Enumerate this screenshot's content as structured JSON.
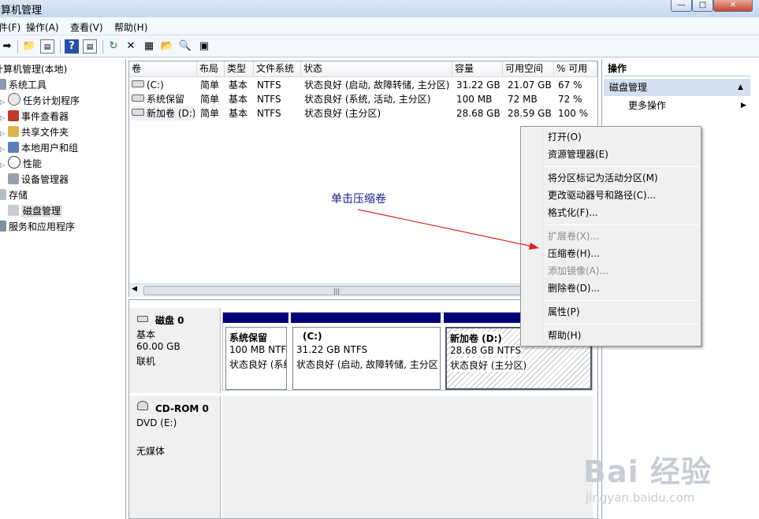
{
  "window": {
    "title": "计算机管理",
    "buttons": [
      "—",
      "□",
      "✕"
    ]
  },
  "menubar": [
    "文件(F)",
    "操作(A)",
    "查看(V)",
    "帮助(H)"
  ],
  "tree": {
    "root": "计算机管理(本地)",
    "system_tools": "系统工具",
    "items": [
      "任务计划程序",
      "事件查看器",
      "共享文件夹",
      "本地用户和组",
      "性能",
      "设备管理器"
    ],
    "storage": "存储",
    "disk_mgmt": "磁盘管理",
    "services": "服务和应用程序"
  },
  "volume_table": {
    "headers": [
      "卷",
      "布局",
      "类型",
      "文件系统",
      "状态",
      "容量",
      "可用空间",
      "% 可用"
    ],
    "rows": [
      [
        "(C:)",
        "简单",
        "基本",
        "NTFS",
        "状态良好 (启动, 故障转储, 主分区)",
        "31.22 GB",
        "21.07 GB",
        "67 %"
      ],
      [
        "系统保留",
        "简单",
        "基本",
        "NTFS",
        "状态良好 (系统, 活动, 主分区)",
        "100 MB",
        "72 MB",
        "72 %"
      ],
      [
        "新加卷 (D:)",
        "简单",
        "基本",
        "NTFS",
        "状态良好 (主分区)",
        "28.68 GB",
        "28.59 GB",
        "100 %"
      ]
    ]
  },
  "disks": {
    "disk0": {
      "name": "磁盘 0",
      "type": "基本",
      "size": "60.00 GB",
      "status": "联机",
      "partitions": [
        {
          "name": "系统保留",
          "size": "100 MB NTFS",
          "status": "状态良好 (系统"
        },
        {
          "name": "(C:)",
          "size": "31.22 GB NTFS",
          "status": "状态良好 (启动, 故障转储, 主分区"
        },
        {
          "name": "新加卷  (D:)",
          "size": "28.68 GB NTFS",
          "status": "状态良好 (主分区)"
        }
      ]
    },
    "cdrom0": {
      "name": "CD-ROM 0",
      "drive": "DVD (E:)",
      "media": "无媒体"
    }
  },
  "actions": {
    "header": "操作",
    "section": "磁盘管理",
    "more": "更多操作"
  },
  "context_menu": {
    "open": "打开(O)",
    "explorer": "资源管理器(E)",
    "mark_active": "将分区标记为活动分区(M)",
    "change_letter": "更改驱动器号和路径(C)...",
    "format": "格式化(F)...",
    "extend": "扩展卷(X)...",
    "shrink": "压缩卷(H)...",
    "mirror": "添加镜像(A)...",
    "delete": "删除卷(D)...",
    "properties": "属性(P)",
    "help": "帮助(H)"
  },
  "annotation": "单击压缩卷",
  "watermark": {
    "brand": "Bai 经验",
    "url": "jingyan.baidu.com"
  },
  "colors": {
    "partition_bar": "#00007a",
    "annotation_arrow": "#e02020",
    "actions_header": "#d3e0f1"
  }
}
